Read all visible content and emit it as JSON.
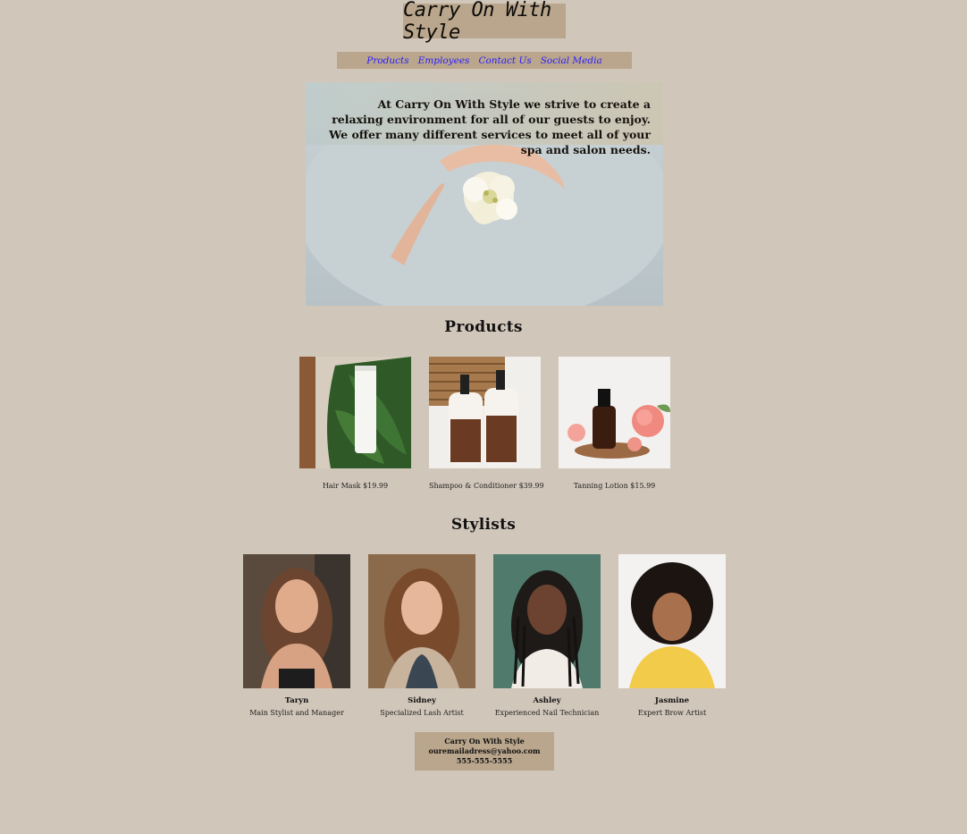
{
  "header": {
    "logo_text": "Carry On With Style"
  },
  "nav": {
    "items": [
      "Products",
      "Employees",
      "Contact Us",
      "Social Media"
    ]
  },
  "hero": {
    "text": "At Carry On With Style we strive to create a relaxing environment for all of our guests to enjoy. We offer many different services to meet all of your spa and salon needs."
  },
  "products": {
    "heading": "Products",
    "items": [
      {
        "caption": "Hair Mask $19.99"
      },
      {
        "caption": "Shampoo & Conditioner $39.99"
      },
      {
        "caption": "Tanning Lotion $15.99"
      }
    ]
  },
  "stylists": {
    "heading": "Stylists",
    "items": [
      {
        "name": "Taryn",
        "role": "Main Stylist and Manager"
      },
      {
        "name": "Sidney",
        "role": "Specialized Lash Artist"
      },
      {
        "name": "Ashley",
        "role": "Experienced Nail Technician"
      },
      {
        "name": "Jasmine",
        "role": "Expert Brow Artist"
      }
    ]
  },
  "footer": {
    "line1": "Carry On With Style",
    "line2": "ouremailadress@yahoo.com",
    "line3": "555-555-5555"
  },
  "colors": {
    "background": "#d1c6ba",
    "panel": "#b9a68c",
    "link": "#2a1bff"
  }
}
